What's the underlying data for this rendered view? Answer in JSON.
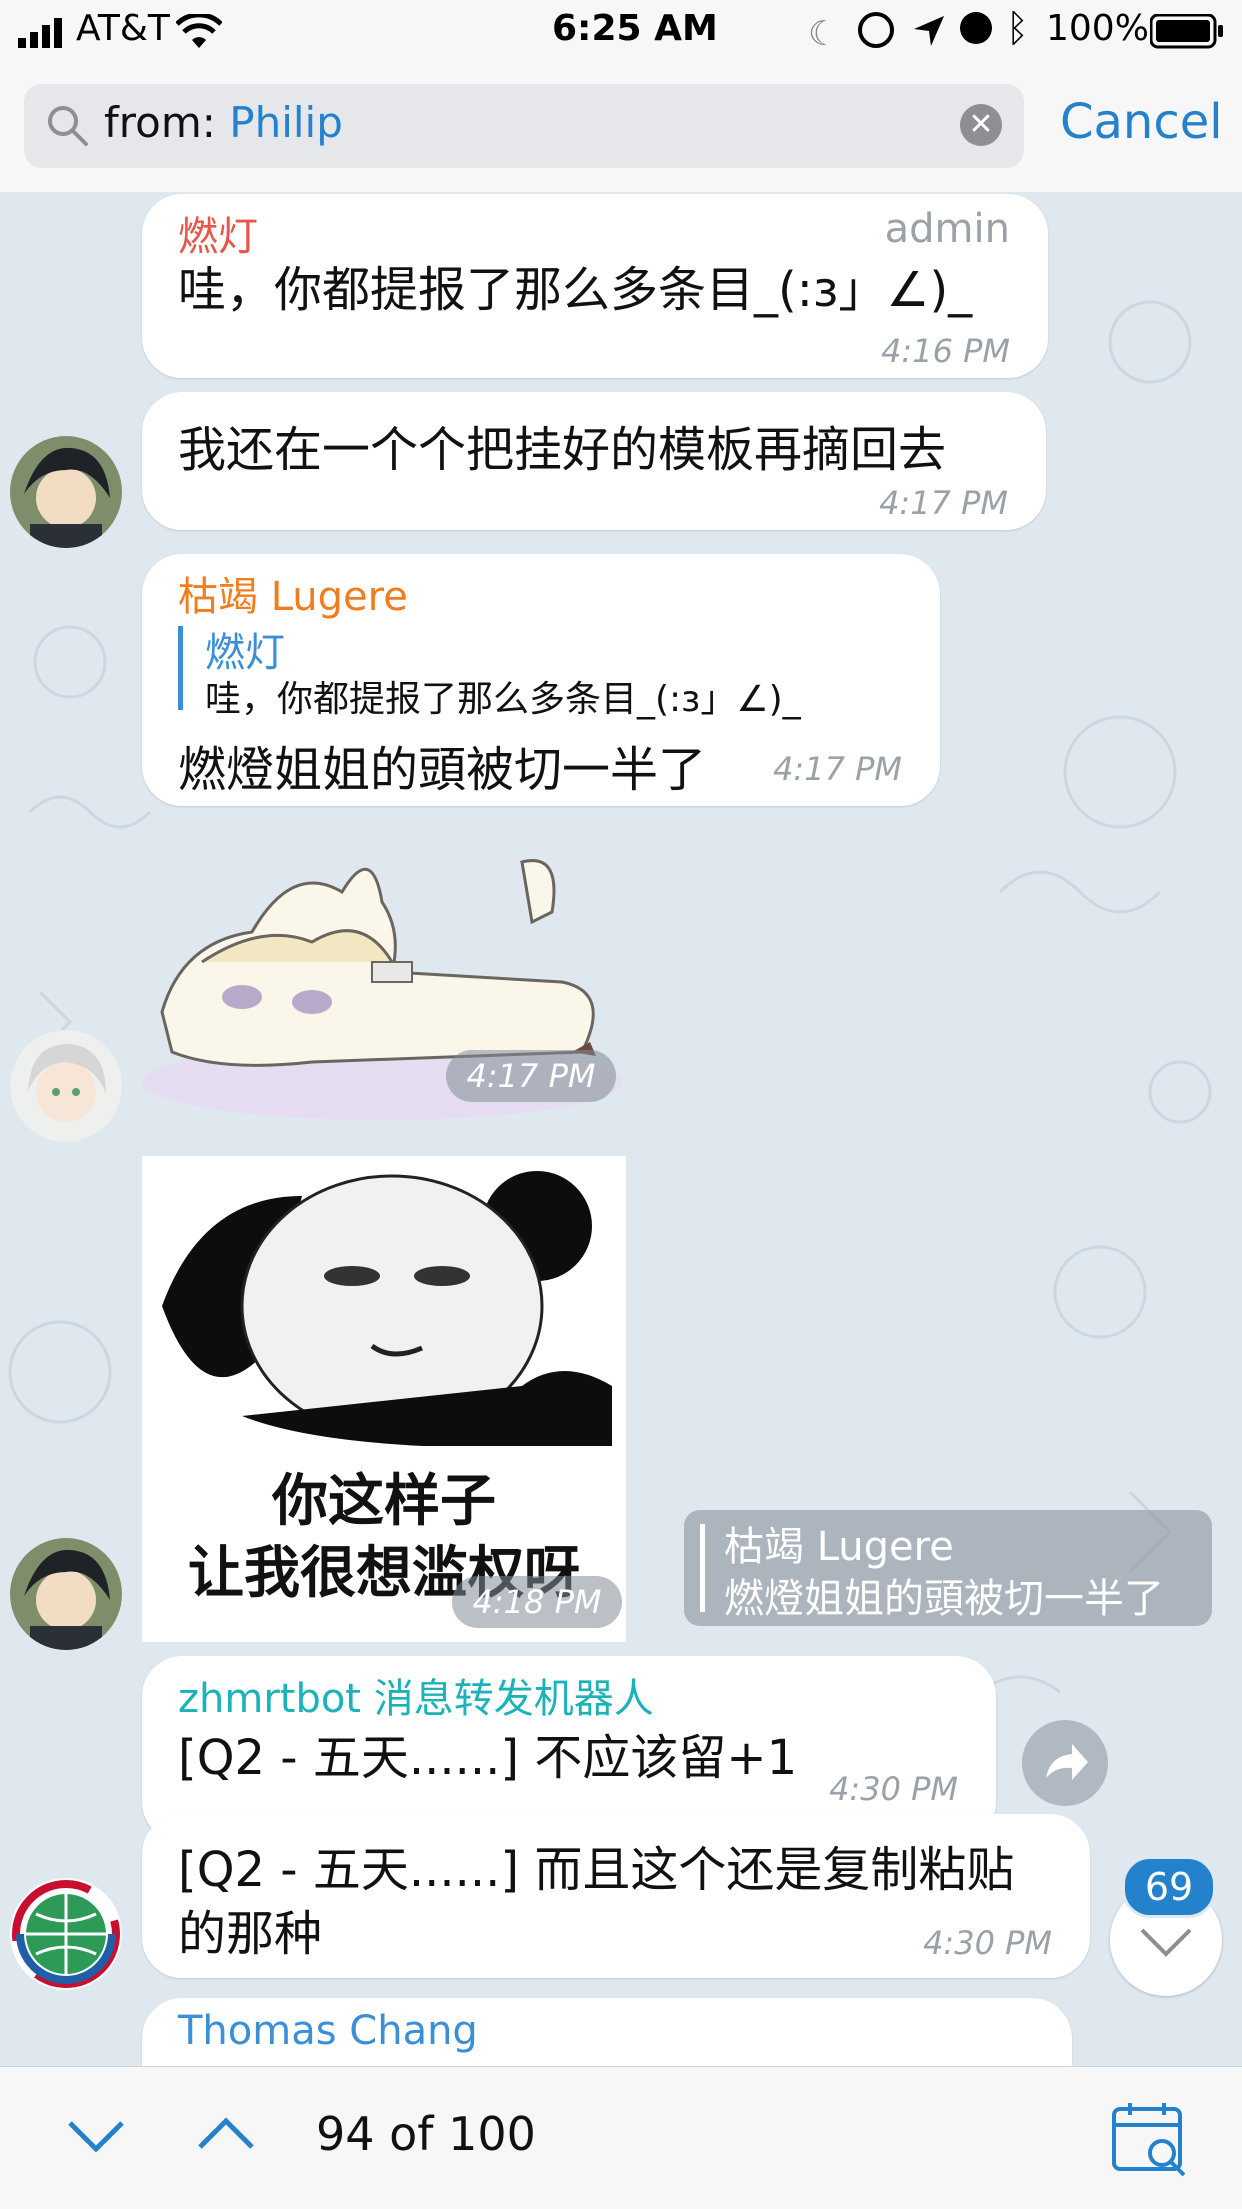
{
  "status": {
    "carrier": "AT&T",
    "time": "6:25 AM",
    "battery": "100%"
  },
  "search": {
    "prefix": "from: ",
    "term": "Philip",
    "cancel_label": "Cancel"
  },
  "messages": [
    {
      "sender": "燃灯",
      "role": "admin",
      "text": "哇，你都提报了那么多条目_(:з」∠)_",
      "time": "4:16 PM"
    },
    {
      "text": "我还在一个个把挂好的模板再摘回去",
      "time": "4:17 PM"
    },
    {
      "sender": "枯竭 Lugere",
      "reply_name": "燃灯",
      "reply_text": "哇，你都提报了那么多条目_(:з」∠)_",
      "text": "燃燈姐姐的頭被切一半了",
      "time": "4:17 PM"
    },
    {
      "time": "4:17 PM"
    },
    {
      "meme_line1": "你这样子",
      "meme_line2": "让我很想滥权呀",
      "reply_name": "枯竭 Lugere",
      "reply_text": "燃燈姐姐的頭被切一半了",
      "time": "4:18 PM"
    },
    {
      "sender": "zhmrtbot 消息转发机器人",
      "text": "[Q2 - 五天......] 不应该留+1",
      "time": "4:30 PM"
    },
    {
      "text_line1": "[Q2 - 五天......] 而且这个还是复制粘贴",
      "text_line2": "的那种",
      "time": "4:30 PM"
    },
    {
      "sender": "Thomas Chang"
    }
  ],
  "unread_badge": "69",
  "toolbar": {
    "counter": "94 of 100"
  },
  "colors": {
    "accent": "#2481cc",
    "name_red": "#e8554a",
    "name_orange": "#f07e1f",
    "name_teal": "#1cb2b9",
    "name_blue": "#3a8fd6"
  }
}
